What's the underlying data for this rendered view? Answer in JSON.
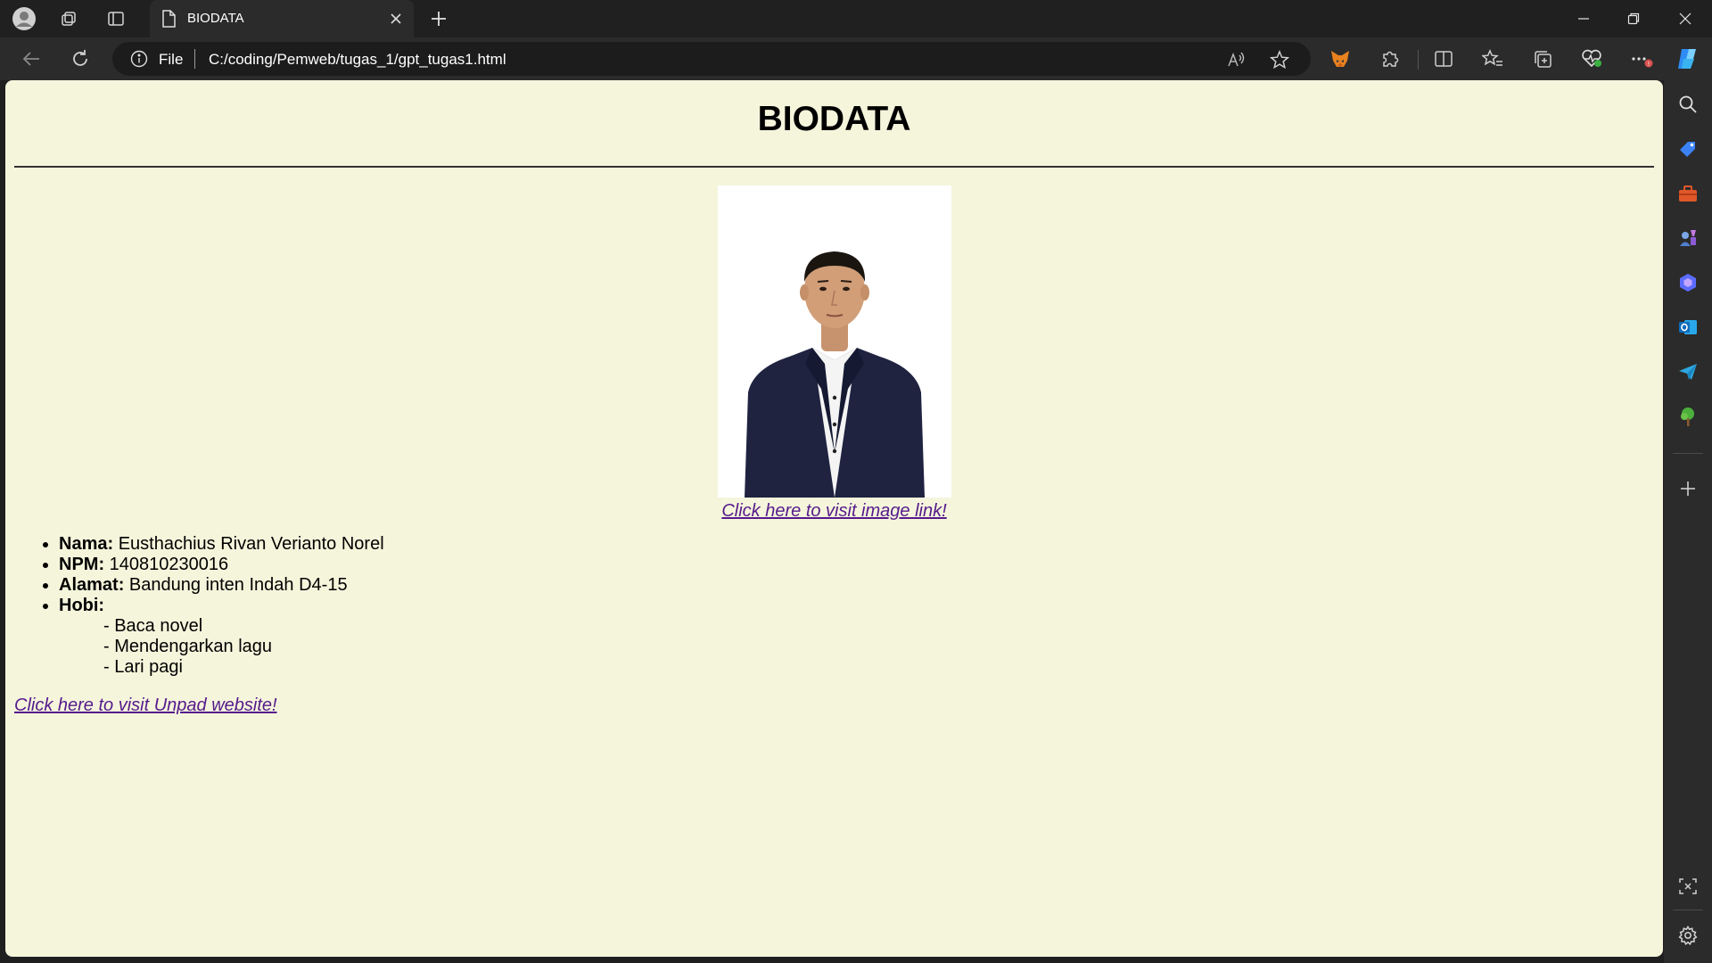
{
  "browser": {
    "tab": {
      "title": "BIODATA"
    },
    "address": {
      "scheme": "File",
      "url": "C:/coding/Pemweb/tugas_1/gpt_tugas1.html"
    },
    "icons": {
      "profile": "profile-icon",
      "workspaces": "workspaces-icon",
      "vertical_tabs": "vertical-tabs-icon",
      "read_aloud": "read-aloud-icon",
      "favorite": "star-icon",
      "metamask": "fox-icon",
      "extensions": "puzzle-icon",
      "split_screen": "split-screen-icon",
      "favorites": "favorites-icon",
      "collections": "collections-icon",
      "browser_essentials": "heart-pulse-icon",
      "more": "more-icon",
      "copilot": "copilot-icon"
    },
    "colors": {
      "chrome": "#202020",
      "toolbar": "#2b2b2b",
      "page_bg": "#f5f5dc",
      "link": "#551a8b"
    }
  },
  "page": {
    "title": "BIODATA",
    "image_link": "Click here to visit image link!",
    "bio": [
      {
        "label": "Nama:",
        "value": "Eusthachius Rivan Verianto Norel"
      },
      {
        "label": "NPM:",
        "value": "140810230016"
      },
      {
        "label": "Alamat:",
        "value": "Bandung inten Indah D4-15"
      },
      {
        "label": "Hobi:",
        "value": ""
      }
    ],
    "hobbies": [
      "- Baca novel",
      "- Mendengarkan lagu",
      "- Lari pagi"
    ],
    "unpad_link": "Click here to visit Unpad website!"
  }
}
